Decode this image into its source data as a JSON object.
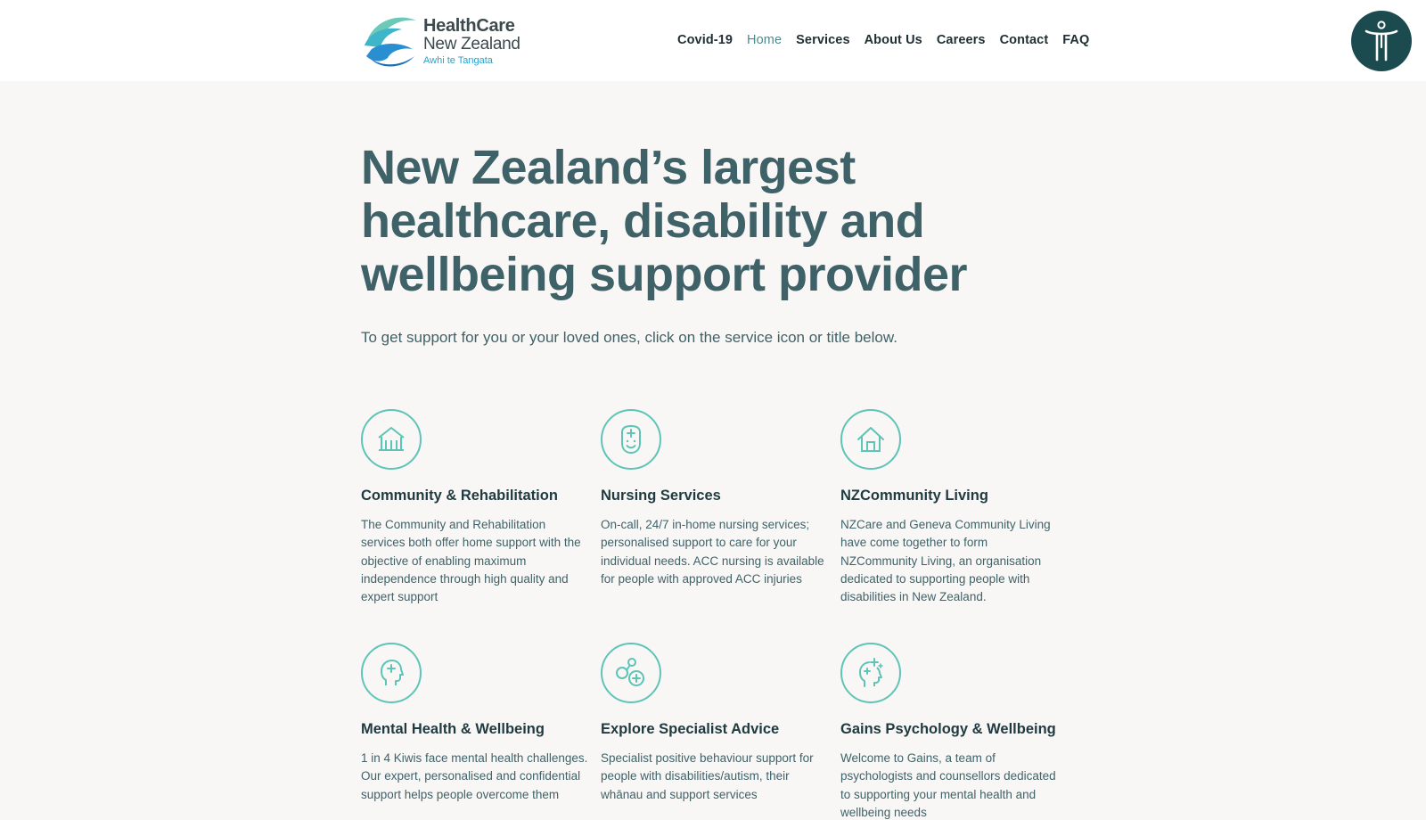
{
  "header": {
    "logo": {
      "line1": "HealthCare",
      "line2": "New Zealand",
      "line3": "Awhi te Tangata"
    },
    "nav": [
      {
        "label": "Covid-19",
        "active": false
      },
      {
        "label": "Home",
        "active": true
      },
      {
        "label": "Services",
        "active": false
      },
      {
        "label": "About Us",
        "active": false
      },
      {
        "label": "Careers",
        "active": false
      },
      {
        "label": "Contact",
        "active": false
      },
      {
        "label": "FAQ",
        "active": false
      }
    ],
    "accessibility_icon": "accessibility-person-icon"
  },
  "hero": {
    "title": "New Zealand’s largest healthcare, disability and wellbeing support provider",
    "subtitle": "To get support for you or your loved ones, click on the service icon or title below."
  },
  "services": [
    {
      "icon": "community-building-icon",
      "title": "Community & Rehabilitation",
      "text": "The Community and Rehabilitation services both offer home support with the objective of enabling maximum independence through high quality and expert support"
    },
    {
      "icon": "nurse-face-icon",
      "title": "Nursing Services",
      "text": "On-call, 24/7 in-home nursing services; personalised support to care for your individual needs. ACC nursing is available for people with approved ACC injuries"
    },
    {
      "icon": "house-icon",
      "title": "NZCommunity Living",
      "text": "NZCare and Geneva Community Living have come together to form NZCommunity Living, an organisation dedicated to supporting people with disabilities in New Zealand."
    },
    {
      "icon": "head-plus-icon",
      "title": "Mental Health & Wellbeing",
      "text": "1 in 4 Kiwis face mental health challenges. Our expert, personalised and confidential support helps people overcome them"
    },
    {
      "icon": "specialist-circles-icon",
      "title": "Explore Specialist Advice",
      "text": "Specialist positive behaviour support for people with disabilities/autism, their whānau and support services"
    },
    {
      "icon": "head-sparkle-icon",
      "title": "Gains Psychology & Wellbeing",
      "text": "Welcome to Gains, a team of psychologists and counsellors dedicated to supporting your mental health and wellbeing needs"
    }
  ],
  "colors": {
    "accent": "#5ec4b6",
    "heading": "#3f6269",
    "access_button": "#1b4b4f",
    "nav_active": "#4d8a90"
  }
}
